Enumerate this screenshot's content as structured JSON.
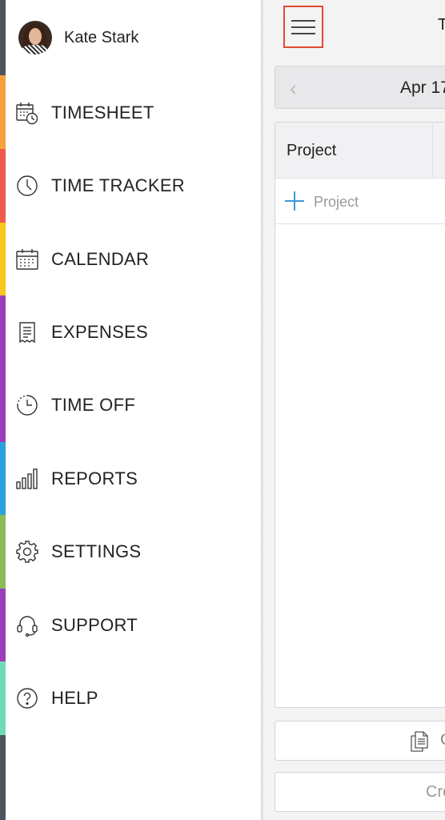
{
  "drawer": {
    "edge_colors": [
      "#4a5560",
      "#f6a13a",
      "#ef5a4c",
      "#f9c61b",
      "#9c3eb9",
      "#9c3eb9",
      "#2aa2e0",
      "#8dbb58",
      "#9c3eb9",
      "#6fdcb6",
      "#4a5560"
    ],
    "user": {
      "name": "Kate Stark",
      "avatar": "avatar-photo"
    },
    "items": [
      {
        "label": "TIMESHEET",
        "icon": "timesheet-icon"
      },
      {
        "label": "TIME TRACKER",
        "icon": "clock-icon"
      },
      {
        "label": "CALENDAR",
        "icon": "calendar-icon"
      },
      {
        "label": "EXPENSES",
        "icon": "receipt-icon"
      },
      {
        "label": "TIME OFF",
        "icon": "time-off-icon"
      },
      {
        "label": "REPORTS",
        "icon": "bar-chart-icon"
      },
      {
        "label": "SETTINGS",
        "icon": "gear-icon"
      },
      {
        "label": "SUPPORT",
        "icon": "headset-icon"
      },
      {
        "label": "HELP",
        "icon": "help-icon"
      }
    ]
  },
  "app": {
    "title_fragment": "T",
    "date_range": "Apr 17",
    "table": {
      "header": "Project",
      "add_row_label": "Project"
    },
    "copy_fragment": "C",
    "create_fragment": "Cre",
    "accent_color": "#3a9ad9",
    "highlight_color": "#e24a36"
  }
}
